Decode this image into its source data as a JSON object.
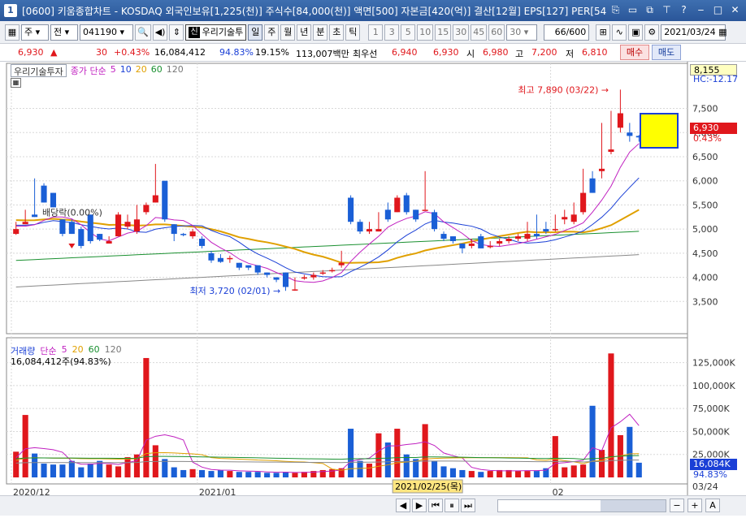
{
  "window": {
    "title": "[0600] 키움종합차트 - KOSDAQ 외국인보유[1,225(천)] 주식수[84,000(천)] 액면[500] 자본금[420(억)] 결산[12월] EPS[127] PER[54",
    "app_icon": "1"
  },
  "toolbar": {
    "market": "주",
    "type": "전",
    "code": "041190",
    "sin": "신",
    "name": "우리기술투",
    "periods": [
      "일",
      "주",
      "월",
      "년",
      "분",
      "초",
      "틱"
    ],
    "selected_period": "일",
    "intervals": [
      "1",
      "3",
      "5",
      "10",
      "15",
      "30",
      "45",
      "60"
    ],
    "interval_value": "30",
    "count": "66",
    "count_total": "/600",
    "date": "2021/03/24"
  },
  "quote": {
    "price": "6,930",
    "arrow": "▲",
    "change": "30",
    "change_pct": "+0.43%",
    "volume": "16,084,412",
    "vol_pct": "94.83%",
    "turnover": "19.15%",
    "amount": "113,007백만",
    "best_label": "최우선",
    "best_ask": "6,940",
    "best_bid": "6,930",
    "open_label": "시",
    "open": "6,980",
    "high_label": "고",
    "high": "7,200",
    "low_label": "저",
    "low": "6,810",
    "buy_label": "매수",
    "sell_label": "매도"
  },
  "legend": {
    "name": "우리기술투자",
    "ma_label": "종가 단순",
    "ma": [
      "5",
      "10",
      "20",
      "60",
      "120"
    ]
  },
  "vol_legend": {
    "name": "거래량",
    "ma_label": "단순",
    "ma": [
      "5",
      "20",
      "60",
      "120"
    ],
    "amount": "16,084,412주(94.83%)"
  },
  "annotations": {
    "high": "최고 7,890 (03/22)",
    "low": "최저 3,720 (02/01)",
    "dividend": "배당락(0.00%)",
    "date_cursor": "2021/02/25(목)",
    "top_price": "8,155",
    "hc": "HC:-12.17",
    "current_price": "6,930",
    "current_pct": "0.43%",
    "vol_current": "16,084K",
    "vol_pct": "94.83%",
    "date_right": "03/24"
  },
  "chart_data": {
    "type": "candlestick",
    "price_ticks": [
      3500,
      4000,
      4500,
      5000,
      5500,
      6000,
      6500,
      7000,
      7500
    ],
    "volume_ticks": [
      "25,000K",
      "50,000K",
      "75,000K",
      "100,000K",
      "125,000K"
    ],
    "x_labels": [
      "2020/12",
      "2021/01",
      "02"
    ],
    "candles": [
      [
        5000,
        5150,
        4900,
        4880,
        "u"
      ],
      [
        5150,
        5400,
        5100,
        5230,
        "u"
      ],
      [
        5300,
        5800,
        5250,
        6050,
        "d"
      ],
      [
        5900,
        5950,
        5550,
        5600,
        "d"
      ],
      [
        5750,
        5700,
        5450,
        5500,
        "d"
      ],
      [
        5200,
        5200,
        4900,
        4850,
        "d"
      ],
      [
        5150,
        5200,
        4900,
        4950,
        "d"
      ],
      [
        5000,
        5050,
        4650,
        4600,
        "d"
      ],
      [
        5300,
        5300,
        4750,
        4700,
        "d"
      ],
      [
        4900,
        4820,
        4780,
        4750,
        "d"
      ],
      [
        4750,
        4850,
        4700,
        4700,
        "u"
      ],
      [
        4850,
        4950,
        5300,
        5350,
        "u"
      ],
      [
        5150,
        5300,
        5050,
        5000,
        "u"
      ],
      [
        5200,
        5500,
        4950,
        4900,
        "u"
      ],
      [
        5500,
        5550,
        5350,
        5300,
        "u"
      ],
      [
        5700,
        5900,
        5550,
        6350,
        "u"
      ],
      [
        6000,
        5900,
        5200,
        5150,
        "d"
      ],
      [
        5100,
        5100,
        4900,
        4750,
        "d"
      ],
      [
        4900,
        4920,
        4880,
        4850,
        "d"
      ],
      [
        4950,
        5000,
        4850,
        4800,
        "u"
      ],
      [
        4800,
        4850,
        4650,
        4600,
        "d"
      ],
      [
        4500,
        4550,
        4350,
        4300,
        "d"
      ],
      [
        4400,
        4480,
        4320,
        4300,
        "d"
      ],
      [
        4400,
        4450,
        4380,
        4300,
        "u"
      ],
      [
        4300,
        4300,
        4200,
        4150,
        "d"
      ],
      [
        4250,
        4250,
        4200,
        4150,
        "d"
      ],
      [
        4250,
        4250,
        4100,
        4050,
        "d"
      ],
      [
        4100,
        4100,
        4050,
        4000,
        "d"
      ],
      [
        4000,
        4000,
        3950,
        3900,
        "d"
      ],
      [
        4100,
        4100,
        3800,
        3720,
        "d"
      ],
      [
        3750,
        4000,
        3750,
        3720,
        "u"
      ],
      [
        4000,
        4050,
        3980,
        3950,
        "u"
      ],
      [
        4050,
        4100,
        4000,
        3950,
        "u"
      ],
      [
        4100,
        4150,
        4100,
        4050,
        "u"
      ],
      [
        4150,
        4200,
        4150,
        4100,
        "u"
      ],
      [
        4300,
        4550,
        4250,
        4200,
        "u"
      ],
      [
        5650,
        5700,
        5150,
        5100,
        "d"
      ],
      [
        5150,
        5200,
        4950,
        4900,
        "d"
      ],
      [
        5000,
        5150,
        4950,
        4900,
        "u"
      ],
      [
        5000,
        5350,
        4950,
        4950,
        "u"
      ],
      [
        5400,
        5550,
        5200,
        5150,
        "d"
      ],
      [
        5350,
        5400,
        5650,
        5700,
        "u"
      ],
      [
        5700,
        5750,
        5350,
        5300,
        "d"
      ],
      [
        5400,
        5400,
        5200,
        5150,
        "d"
      ],
      [
        5400,
        5650,
        5400,
        6200,
        "u"
      ],
      [
        5350,
        5400,
        5000,
        4950,
        "d"
      ],
      [
        4900,
        4950,
        4800,
        4750,
        "d"
      ],
      [
        4850,
        4850,
        4750,
        4700,
        "d"
      ],
      [
        4700,
        4700,
        4600,
        4500,
        "d"
      ],
      [
        4700,
        4800,
        4650,
        4600,
        "u"
      ],
      [
        4850,
        4900,
        4600,
        4600,
        "d"
      ],
      [
        4650,
        4750,
        4650,
        4600,
        "u"
      ],
      [
        4750,
        4800,
        4700,
        4650,
        "u"
      ],
      [
        4800,
        4850,
        4750,
        4700,
        "u"
      ],
      [
        4850,
        4900,
        4800,
        4750,
        "u"
      ],
      [
        4900,
        5150,
        4800,
        4750,
        "u"
      ],
      [
        4850,
        5300,
        4900,
        4800,
        "d"
      ],
      [
        5000,
        5150,
        4950,
        4900,
        "d"
      ],
      [
        5000,
        5300,
        5000,
        4950,
        "u"
      ],
      [
        5250,
        5400,
        5200,
        5100,
        "u"
      ],
      [
        5300,
        5550,
        5150,
        5100,
        "u"
      ],
      [
        5750,
        6250,
        5350,
        5300,
        "u"
      ],
      [
        5750,
        5950,
        6050,
        6200,
        "d"
      ],
      [
        6200,
        7200,
        6250,
        6050,
        "u"
      ],
      [
        6600,
        7450,
        6650,
        6550,
        "u"
      ],
      [
        7400,
        7890,
        7100,
        7000,
        "u"
      ],
      [
        7000,
        7200,
        6930,
        6810,
        "d"
      ],
      [
        6900,
        6950,
        6930,
        6810,
        "d"
      ]
    ],
    "volume": [
      28,
      68,
      26,
      15,
      14,
      14,
      18,
      11,
      15,
      18,
      14,
      12,
      22,
      25,
      130,
      35,
      20,
      11,
      8,
      9,
      8,
      7,
      8,
      7,
      6,
      6,
      6,
      5,
      5,
      6,
      5,
      6,
      7,
      8,
      9,
      10,
      53,
      18,
      15,
      48,
      38,
      53,
      25,
      20,
      58,
      18,
      12,
      10,
      8,
      7,
      6,
      7,
      8,
      8,
      7,
      7,
      7,
      10,
      45,
      11,
      13,
      14,
      78,
      30,
      135,
      46,
      55,
      16
    ],
    "volume_up": [
      true,
      true,
      false,
      false,
      false,
      false,
      false,
      false,
      false,
      false,
      true,
      true,
      true,
      true,
      true,
      true,
      false,
      false,
      false,
      true,
      false,
      false,
      false,
      true,
      false,
      false,
      false,
      false,
      false,
      false,
      true,
      true,
      true,
      true,
      true,
      true,
      false,
      false,
      true,
      true,
      false,
      true,
      false,
      false,
      true,
      false,
      false,
      false,
      false,
      true,
      false,
      true,
      true,
      true,
      true,
      true,
      false,
      false,
      true,
      true,
      true,
      true,
      false,
      true,
      true,
      true,
      false,
      false
    ]
  }
}
